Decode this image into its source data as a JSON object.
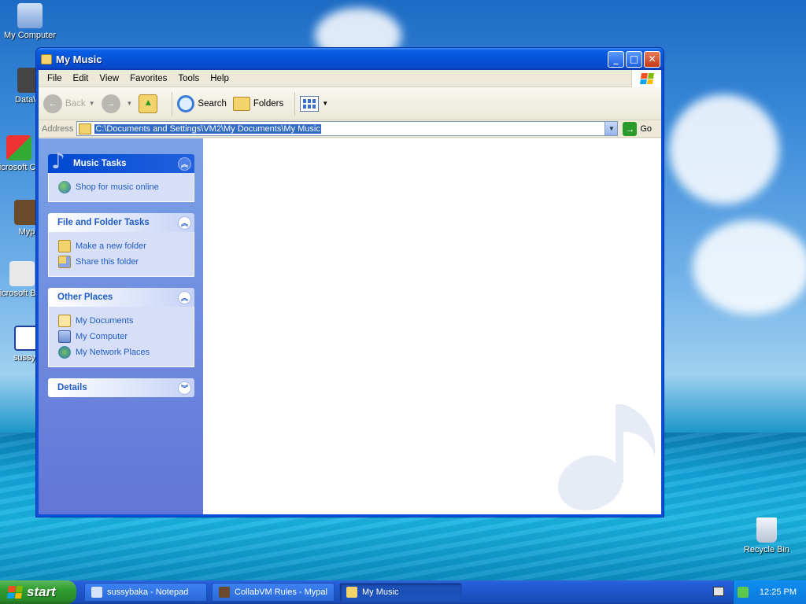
{
  "desktop": {
    "icons": [
      {
        "label": "My Computer"
      },
      {
        "label": "DataWar"
      },
      {
        "label": "Microsoft C++"
      },
      {
        "label": "Myp"
      },
      {
        "label": "Microsoft Basic"
      },
      {
        "label": "sussyb"
      },
      {
        "label": "Recycle Bin"
      }
    ]
  },
  "window": {
    "title": "My Music",
    "buttons": {
      "minimize": "_",
      "maximize": "□",
      "close": "✕"
    }
  },
  "menubar": {
    "items": [
      "File",
      "Edit",
      "View",
      "Favorites",
      "Tools",
      "Help"
    ]
  },
  "toolbar": {
    "back": "Back",
    "search": "Search",
    "folders": "Folders"
  },
  "address": {
    "label": "Address",
    "path": "C:\\Documents and Settings\\VM2\\My Documents\\My Music",
    "go": "Go"
  },
  "taskpane": {
    "music_tasks": {
      "title": "Music Tasks",
      "items": [
        "Shop for music online"
      ]
    },
    "file_tasks": {
      "title": "File and Folder Tasks",
      "items": [
        "Make a new folder",
        "Share this folder"
      ]
    },
    "other_places": {
      "title": "Other Places",
      "items": [
        "My Documents",
        "My Computer",
        "My Network Places"
      ]
    },
    "details": {
      "title": "Details"
    }
  },
  "taskbar": {
    "start": "start",
    "tasks": [
      "sussybaka - Notepad",
      "CollabVM Rules - Mypal",
      "My Music"
    ],
    "clock": "12:25 PM"
  },
  "colors": {
    "titlebar": "#0553d6",
    "taskpane_link": "#215dc6",
    "selection": "#316ac5"
  }
}
